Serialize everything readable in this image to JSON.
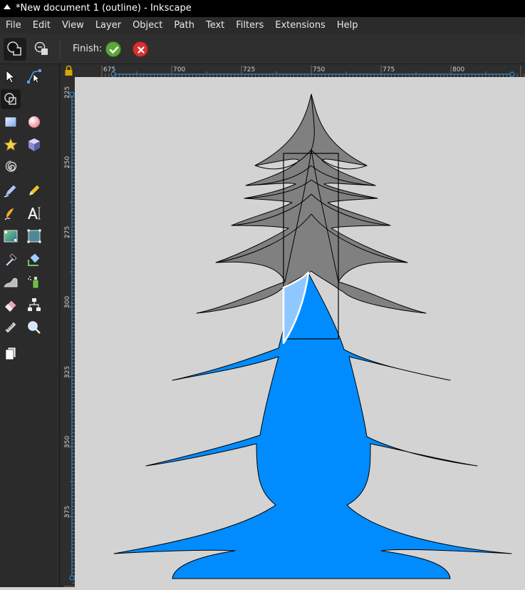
{
  "window": {
    "title": "*New document 1 (outline) - Inkscape"
  },
  "menubar": {
    "items": [
      "File",
      "Edit",
      "View",
      "Layer",
      "Object",
      "Path",
      "Text",
      "Filters",
      "Extensions",
      "Help"
    ]
  },
  "toolctrl": {
    "finish_label": "Finish:"
  },
  "rulers": {
    "horizontal": [
      "675",
      "700",
      "725",
      "750",
      "775",
      "800"
    ],
    "vertical": [
      "225",
      "250",
      "275",
      "300",
      "325",
      "350",
      "375"
    ]
  },
  "colors": {
    "tree_fill": "#008cff",
    "gray_fill": "#808080",
    "canvas": "#d3d3d3",
    "ruler_accent": "#2a8ad8"
  },
  "tools": [
    "selector-icon",
    "node-editor-icon",
    "shape-builder-icon",
    "rectangle-icon",
    "ellipse-icon",
    "star-icon",
    "3d-box-icon",
    "spiral-icon",
    "pen-icon",
    "pencil-icon",
    "calligraphy-icon",
    "text-icon",
    "gradient-icon",
    "mesh-icon",
    "dropper-icon",
    "paint-bucket-icon",
    "tweak-icon",
    "spray-icon",
    "eraser-icon",
    "connector-icon",
    "measure-icon",
    "zoom-icon",
    "pages-icon"
  ]
}
